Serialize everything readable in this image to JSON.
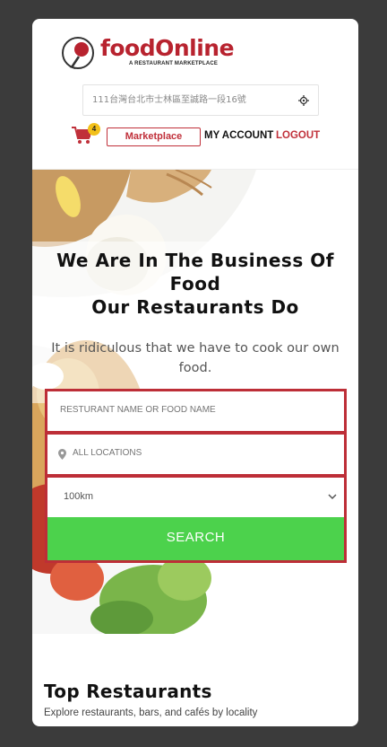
{
  "brand": {
    "name": "foodOnline",
    "tagline": "A RESTAURANT MARKETPLACE",
    "primary_color": "#b8232f",
    "icon": "wine-glass-logo-icon"
  },
  "header": {
    "address_value": "111台灣台北市士林區至誠路一段16號",
    "locate_icon": "crosshair-icon",
    "cart_icon": "shopping-cart-icon",
    "cart_count": "4",
    "marketplace_label": "Marketplace",
    "my_account_label": "MY ACCOUNT",
    "logout_label": "LOGOUT"
  },
  "hero": {
    "title_line1": "We Are In The Business Of",
    "title_line2": "Food",
    "title_line3": "Our Restaurants Do",
    "subtitle": "It is ridiculous that we have to cook our own food."
  },
  "search_form": {
    "name_placeholder": "RESTURANT NAME OR FOOD NAME",
    "location_placeholder": "ALL LOCATIONS",
    "location_icon": "map-pin-icon",
    "radius_selected": "100km",
    "search_label": "SEARCH",
    "border_color": "#bd2e37",
    "button_color": "#4cd24c"
  },
  "top_restaurants": {
    "title": "Top Restaurants",
    "subtitle": "Explore restaurants, bars, and cafés by locality"
  }
}
